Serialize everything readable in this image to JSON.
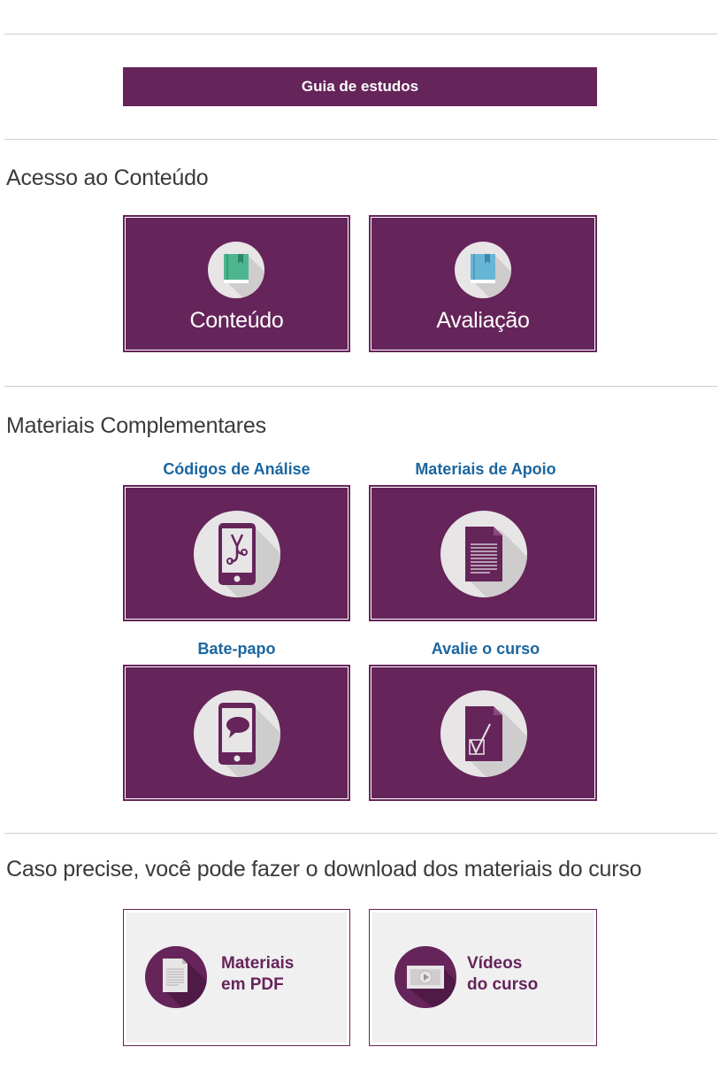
{
  "guide_button": {
    "label": "Guia de estudos"
  },
  "access": {
    "title": "Acesso ao Conteúdo",
    "tiles": [
      {
        "label": "Conteúdo",
        "icon": "book-green-icon",
        "color": "#4db691"
      },
      {
        "label": "Avaliação",
        "icon": "book-blue-icon",
        "color": "#68b6d6"
      }
    ]
  },
  "complementary": {
    "title": "Materiais Complementares",
    "items": [
      {
        "title": "Códigos de Análise",
        "icon": "tablet-stethoscope-icon"
      },
      {
        "title": "Materiais de Apoio",
        "icon": "document-icon"
      },
      {
        "title": "Bate-papo",
        "icon": "tablet-chat-icon"
      },
      {
        "title": "Avalie o curso",
        "icon": "checklist-icon"
      }
    ]
  },
  "download": {
    "title": "Caso precise, você pode fazer o download dos materiais do curso",
    "items": [
      {
        "line1": "Materiais",
        "line2": "em PDF",
        "icon": "pdf-document-icon"
      },
      {
        "line1": "Vídeos",
        "line2": "do curso",
        "icon": "video-player-icon"
      }
    ]
  },
  "colors": {
    "primary": "#65245a",
    "link": "#1b66a0",
    "divider": "#cfcfcf"
  }
}
